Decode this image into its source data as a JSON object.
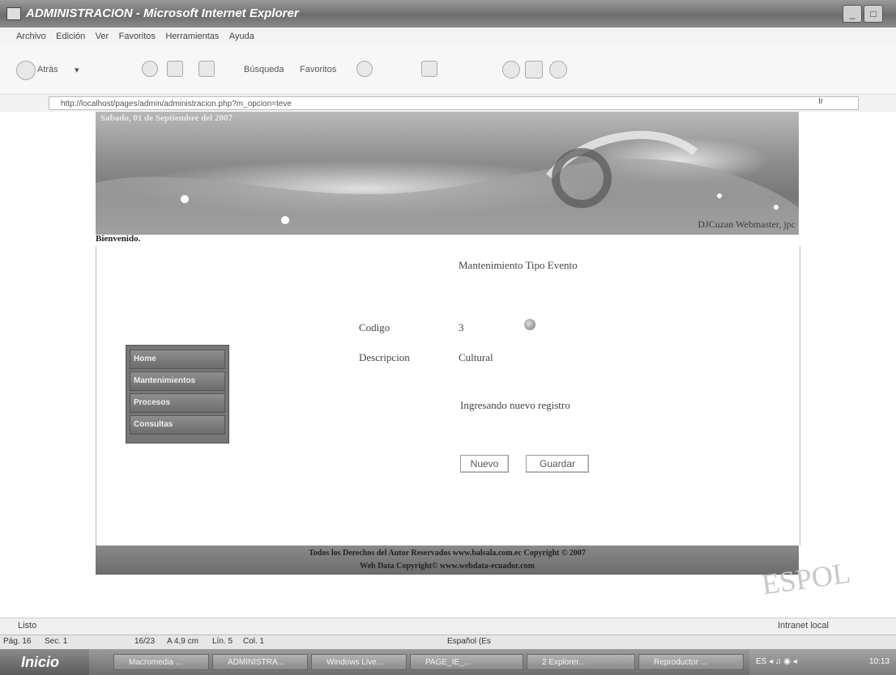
{
  "window": {
    "title": "ADMINISTRACION - Microsoft Internet Explorer",
    "controls": [
      "_",
      "□"
    ]
  },
  "menu": [
    "Archivo",
    "Edición",
    "Ver",
    "Favoritos",
    "Herramientas",
    "Ayuda"
  ],
  "toolbar": {
    "back_label": "Atrás",
    "search_label": "Búsqueda",
    "favorites_label": "Favoritos"
  },
  "address": {
    "url": "http://localhost/pages/admin/administracion.php?m_opcion=teve",
    "go_label": "Ir"
  },
  "banner": {
    "date": "Sabado, 01 de Septiembre del 2007",
    "webmaster": "DJCuzan Webmaster, jpc"
  },
  "welcome": "Bienvenido.",
  "form": {
    "heading": "Mantenimiento Tipo Evento",
    "codigo_label": "Codigo",
    "codigo_value": "3",
    "descripcion_label": "Descripcion",
    "descripcion_value": "Cultural",
    "status_message": "Ingresando nuevo registro",
    "new_button": "Nuevo",
    "save_button": "Guardar"
  },
  "leftnav": {
    "items": [
      "Home",
      "Mantenimientos",
      "Procesos",
      "Consultas"
    ]
  },
  "footer": {
    "line1": "Todos los Derechos del Autor Reservados www.balsala.com.ec Copyright © 2007",
    "line2": "Web Data Copyright© www.webdata-ecuador.com"
  },
  "stamp": "ESPOL",
  "statusbar": {
    "left": "Listo",
    "right": "Intranet local"
  },
  "word_status": {
    "pag": "Pág. 16",
    "sec": "Sec. 1",
    "pages": "16/23",
    "pos": "A 4,9 cm",
    "lin": "Lín. 5",
    "col": "Col. 1",
    "lang": "Español (Es"
  },
  "taskbar": {
    "start": "Inicio",
    "tasks": [
      "Macromedia ...",
      "ADMINISTRA...",
      "Windows Live...",
      "PAGE_IE_...",
      "2 Explorer...",
      "Reproductor ..."
    ],
    "clock": "10:13"
  }
}
